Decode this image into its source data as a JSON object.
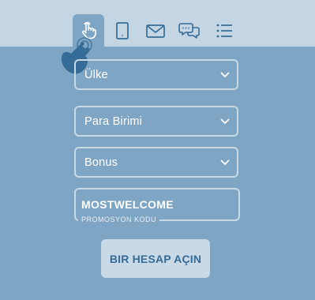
{
  "tabs": [
    {
      "icon": "touch-icon",
      "active": true
    },
    {
      "icon": "tablet-icon",
      "active": false
    },
    {
      "icon": "mail-icon",
      "active": false
    },
    {
      "icon": "chat-icon",
      "active": false
    },
    {
      "icon": "list-icon",
      "active": false
    }
  ],
  "form": {
    "country": {
      "value": "Ülke"
    },
    "currency": {
      "value": "Para Birimi"
    },
    "bonus": {
      "value": "Bonus"
    },
    "promo": {
      "value": "MOSTWELCOME",
      "caption": "PROMOSYON KODU"
    },
    "submit_label": "BIR HESAP AÇIN"
  },
  "colors": {
    "background": "#7ea5c4",
    "topbar": "#c4d6e4",
    "icon": "#356c97",
    "button_bg": "#cad9e6",
    "button_text": "#356c97"
  }
}
